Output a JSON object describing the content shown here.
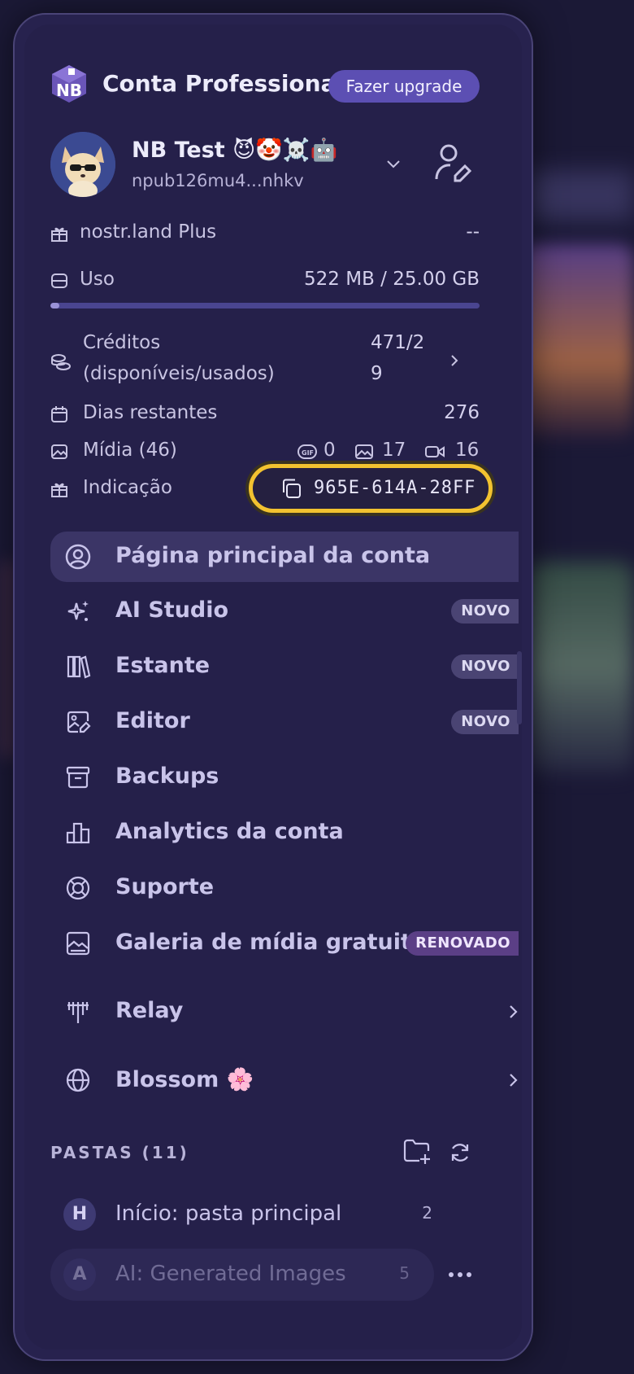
{
  "header": {
    "account_title": "Conta Professional",
    "upgrade_label": "Fazer upgrade"
  },
  "user": {
    "name": "NB Test 😈🤡☠️🤖",
    "npub": "npub126mu4...nhkv"
  },
  "stats": {
    "plus_label": "nostr.land Plus",
    "plus_value": "--",
    "usage_label": "Uso",
    "usage_value": "522 MB / 25.00 GB",
    "usage_fraction": 0.02,
    "credits_label_line1": "Créditos",
    "credits_label_line2": "(disponíveis/usados)",
    "credits_value_line1": "471/2",
    "credits_value_line2": "9",
    "days_label": "Dias restantes",
    "days_value": "276",
    "media_label": "Mídia (46)",
    "media_gif": "0",
    "media_images": "17",
    "media_videos": "16",
    "referral_label": "Indicação",
    "referral_code": "965E-614A-28FF"
  },
  "nav": [
    {
      "label": "Página principal da conta",
      "icon": "user-circle-icon"
    },
    {
      "label": "AI Studio",
      "icon": "sparkles-icon",
      "badge": "NOVO"
    },
    {
      "label": "Estante",
      "icon": "library-icon",
      "badge": "NOVO"
    },
    {
      "label": "Editor",
      "icon": "image-edit-icon",
      "badge": "NOVO"
    },
    {
      "label": "Backups",
      "icon": "archive-icon"
    },
    {
      "label": "Analytics da conta",
      "icon": "bar-chart-icon"
    },
    {
      "label": "Suporte",
      "icon": "lifebuoy-icon"
    },
    {
      "label": "Galeria de mídia gratuita",
      "icon": "gallery-icon",
      "badge": "RENOVADO"
    },
    {
      "label": "Relay",
      "icon": "antenna-icon"
    },
    {
      "label": "Blossom 🌸",
      "icon": "globe-icon"
    }
  ],
  "folders": {
    "title": "PASTAS (11)",
    "items": [
      {
        "avatar": "H",
        "label": "Início: pasta principal",
        "count": "2"
      },
      {
        "avatar": "A",
        "label": "AI: Generated Images",
        "count": "5"
      }
    ]
  },
  "colors": {
    "accent": "#5c4fb3",
    "highlight": "#f2c230",
    "panel": "#25204a"
  }
}
